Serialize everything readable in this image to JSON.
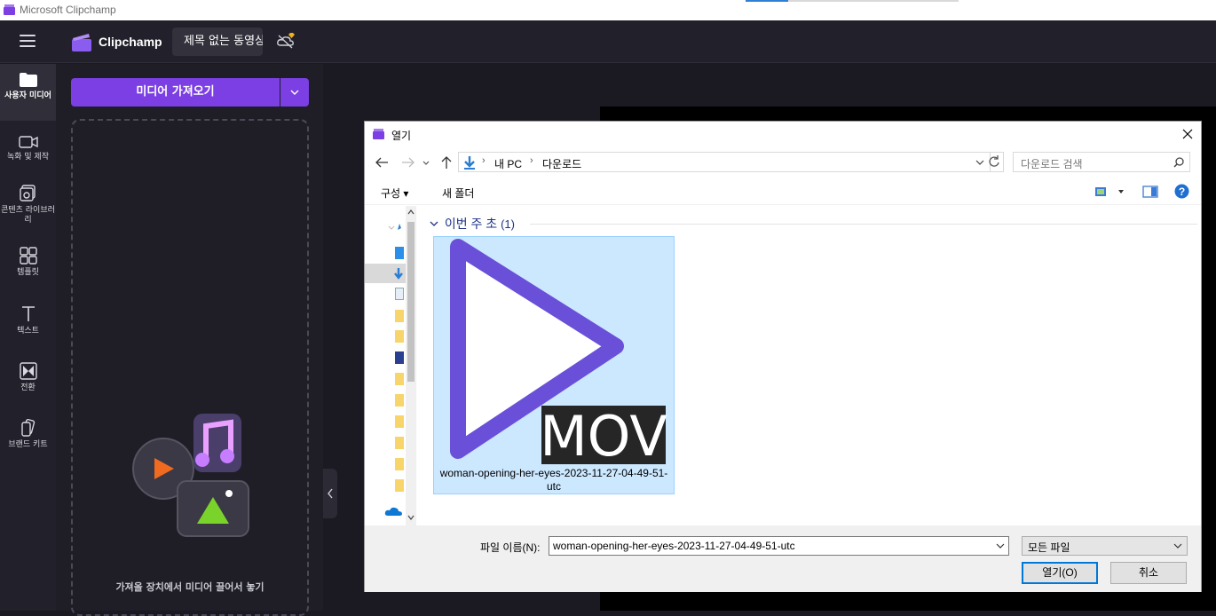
{
  "window": {
    "title": "Microsoft Clipchamp"
  },
  "header": {
    "brand": "Clipchamp",
    "project_title": "제목 없는 동영상"
  },
  "nav": {
    "items": [
      {
        "label": "사용자 미디어",
        "icon": "folder-icon"
      },
      {
        "label": "녹화 및 제작",
        "icon": "video-camera-icon"
      },
      {
        "label": "콘텐츠 라이브러리",
        "icon": "content-library-icon"
      },
      {
        "label": "템플릿",
        "icon": "templates-icon"
      },
      {
        "label": "텍스트",
        "icon": "text-icon"
      },
      {
        "label": "전환",
        "icon": "transition-icon"
      },
      {
        "label": "브랜드 키트",
        "icon": "brand-kit-icon"
      }
    ]
  },
  "panel": {
    "import_label": "미디어 가져오기",
    "drop_text": "가져올 장치에서 미디어 끌어서 놓기"
  },
  "dialog": {
    "title": "열기",
    "address": {
      "root": "내 PC",
      "folder": "다운로드"
    },
    "search_placeholder": "다운로드 검색",
    "toolbar": {
      "organize": "구성",
      "new_folder": "새 폴더"
    },
    "group": {
      "label": "이번 주 초",
      "count": "(1)"
    },
    "file": {
      "name": "woman-opening-her-eyes-2023-11-27-04-49-51-utc",
      "badge": "MOV"
    },
    "filename_label": "파일 이름(N):",
    "filename_value": "woman-opening-her-eyes-2023-11-27-04-49-51-utc",
    "filetype": "모든 파일",
    "open_label": "열기(O)",
    "cancel_label": "취소"
  },
  "colors": {
    "accent": "#7b3fe4",
    "selection": "#cce8ff",
    "play_purple": "#6a4fd8"
  }
}
